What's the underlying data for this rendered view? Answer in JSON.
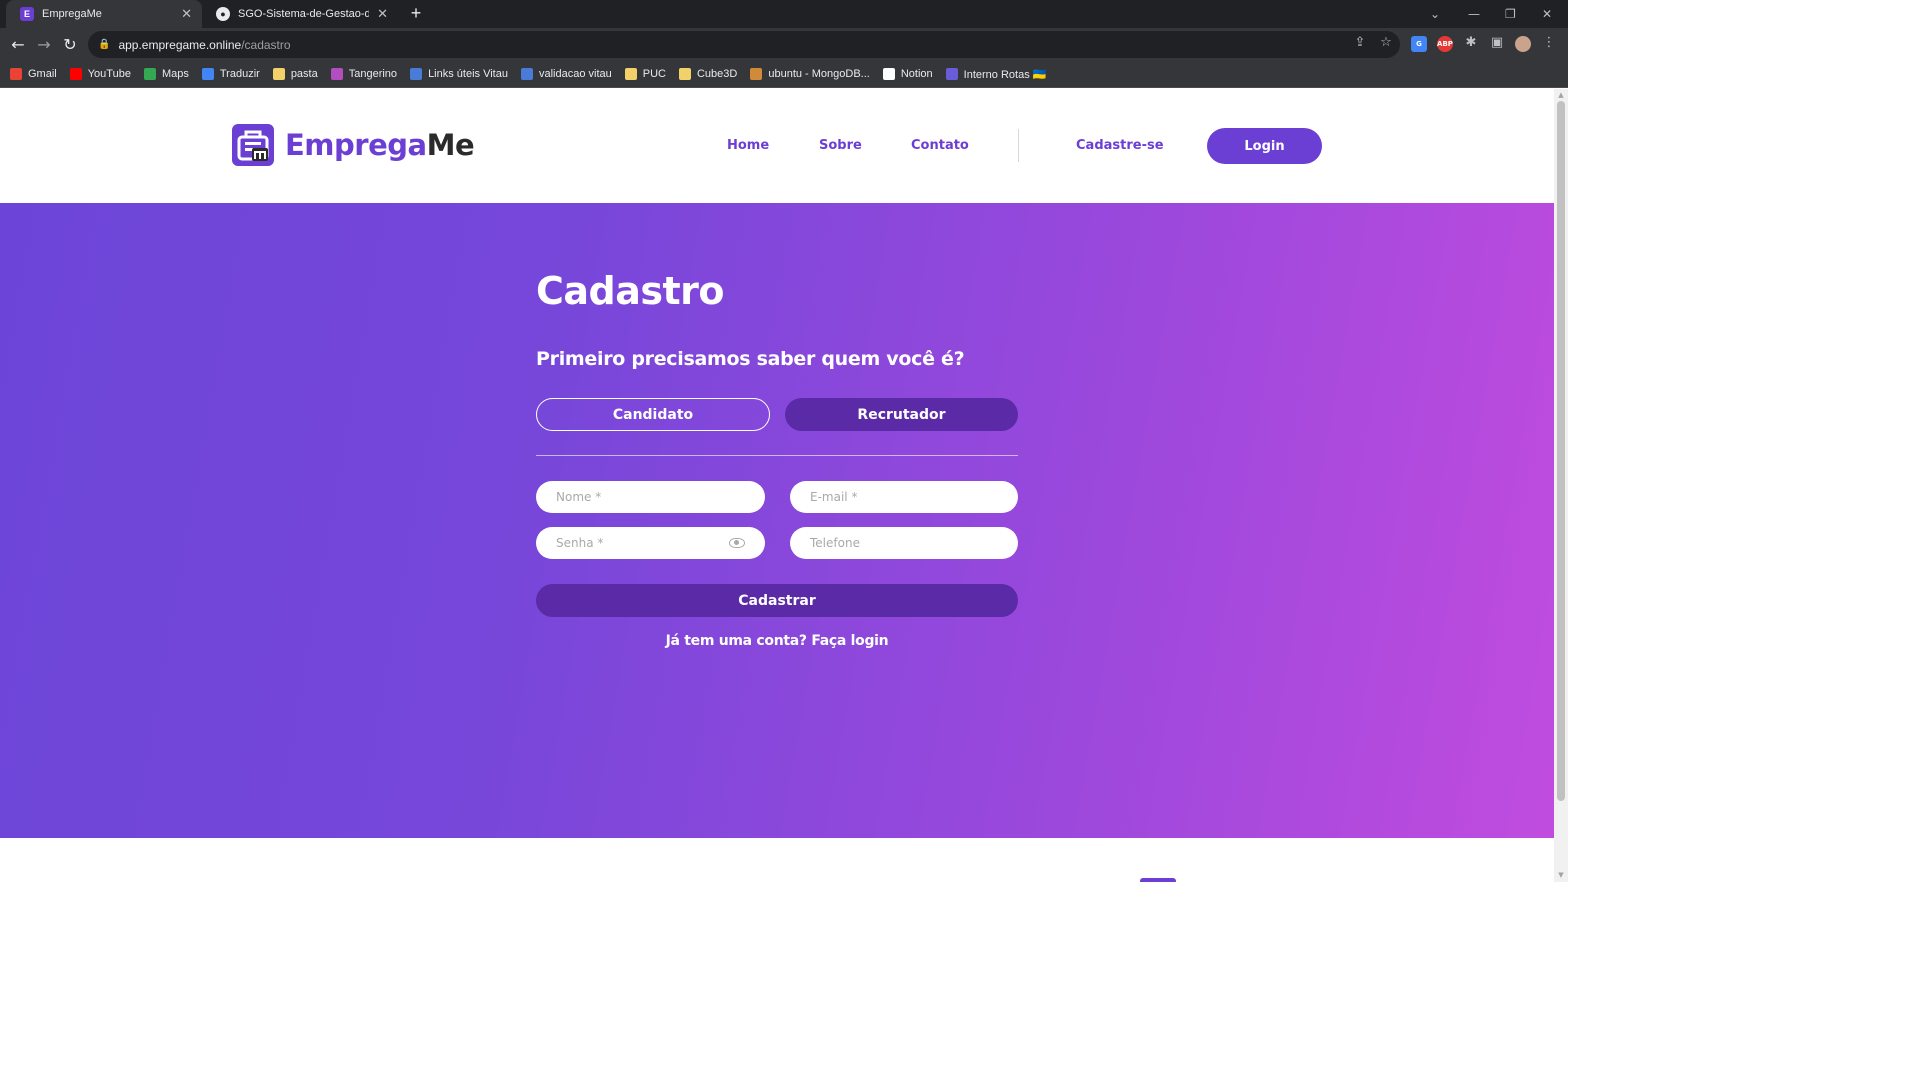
{
  "browser": {
    "tabs": [
      {
        "title": "EmpregaMe",
        "active": true
      },
      {
        "title": "SGO-Sistema-de-Gestao-de-ON",
        "active": false
      }
    ],
    "url_host": "app.empregame.online",
    "url_path": "/cadastro",
    "bookmarks": [
      {
        "label": "Gmail",
        "icon": "gmail-icon",
        "color": "#ea4335"
      },
      {
        "label": "YouTube",
        "icon": "youtube-icon",
        "color": "#ff0000"
      },
      {
        "label": "Maps",
        "icon": "maps-icon",
        "color": "#34a853"
      },
      {
        "label": "Traduzir",
        "icon": "translate-icon",
        "color": "#4285f4"
      },
      {
        "label": "pasta",
        "icon": "folder-icon",
        "color": "#f2d16b"
      },
      {
        "label": "Tangerino",
        "icon": "tangerino-icon",
        "color": "#b24ec0"
      },
      {
        "label": "Links úteis Vitau",
        "icon": "vitau-icon",
        "color": "#4a7bd6"
      },
      {
        "label": "validacao vitau",
        "icon": "vitau-icon",
        "color": "#4a7bd6"
      },
      {
        "label": "PUC",
        "icon": "folder-icon",
        "color": "#f2d16b"
      },
      {
        "label": "Cube3D",
        "icon": "folder-icon",
        "color": "#f2d16b"
      },
      {
        "label": "ubuntu - MongoDB...",
        "icon": "ubuntu-icon",
        "color": "#d08a3a"
      },
      {
        "label": "Notion",
        "icon": "notion-icon",
        "color": "#ffffff"
      },
      {
        "label": "Interno Rotas 🇺🇦",
        "icon": "rotas-icon",
        "color": "#6a5cd8"
      }
    ]
  },
  "site": {
    "logo_primary": "Emprega",
    "logo_secondary": "Me",
    "nav": {
      "home": "Home",
      "sobre": "Sobre",
      "contato": "Contato",
      "cadastre": "Cadastre-se",
      "login": "Login"
    },
    "accent_color": "#6c3fd4"
  },
  "form": {
    "title": "Cadastro",
    "question": "Primeiro precisamos saber quem você é?",
    "role_candidate": "Candidato",
    "role_recruiter": "Recrutador",
    "selected_role": "Recrutador",
    "nome_placeholder": "Nome *",
    "email_placeholder": "E-mail *",
    "senha_placeholder": "Senha *",
    "telefone_placeholder": "Telefone",
    "submit": "Cadastrar",
    "login_prompt": "Já tem uma conta? Faça login"
  }
}
